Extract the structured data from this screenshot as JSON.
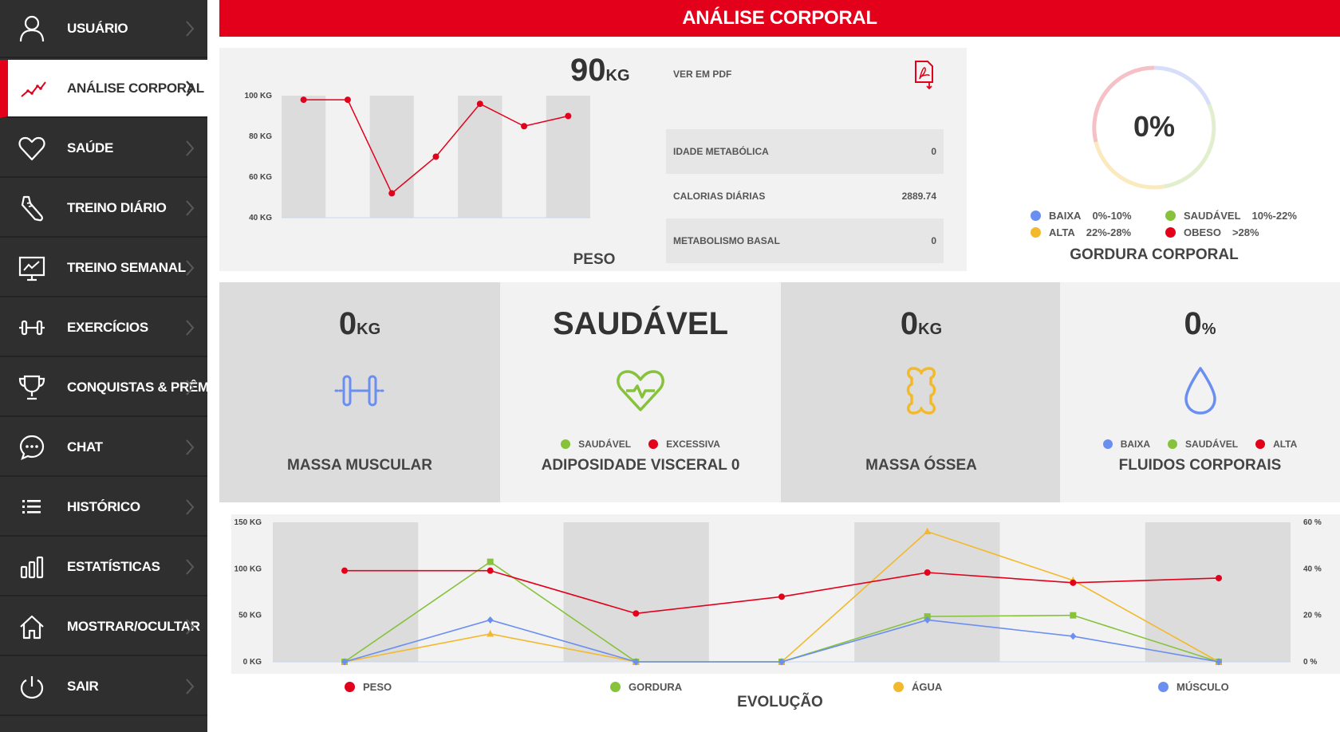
{
  "colors": {
    "brand_red": "#e3001b",
    "sidebar_bg": "#2f2f2f",
    "blue": "#6b8ff0",
    "green": "#86c23a",
    "yellow": "#f2b92d",
    "red": "#e3001b"
  },
  "sidebar": {
    "items": [
      {
        "label": "USUÁRIO",
        "icon": "user-icon",
        "active": false
      },
      {
        "label": "ANÁLISE CORPORAL",
        "icon": "trend-line-icon",
        "active": true
      },
      {
        "label": "SAÚDE",
        "icon": "heart-icon",
        "active": false
      },
      {
        "label": "TREINO DIÁRIO",
        "icon": "shoe-icon",
        "active": false
      },
      {
        "label": "TREINO SEMANAL",
        "icon": "presentation-board-icon",
        "active": false
      },
      {
        "label": "EXERCÍCIOS",
        "icon": "dumbbell-icon",
        "active": false
      },
      {
        "label": "CONQUISTAS & PRÊMIOS",
        "icon": "trophy-icon",
        "active": false
      },
      {
        "label": "CHAT",
        "icon": "chat-bubble-icon",
        "active": false
      },
      {
        "label": "HISTÓRICO",
        "icon": "list-icon",
        "active": false
      },
      {
        "label": "ESTATÍSTICAS",
        "icon": "bar-chart-icon",
        "active": false
      },
      {
        "label": "MOSTRAR/OCULTAR",
        "icon": "home-icon",
        "active": false
      },
      {
        "label": "SAIR",
        "icon": "power-icon",
        "active": false
      }
    ]
  },
  "header": {
    "title": "ANÁLISE CORPORAL"
  },
  "peso": {
    "value": "90",
    "unit": "KG",
    "title": "PESO",
    "chart_data": {
      "type": "line",
      "title": "",
      "ylabel": "",
      "ylim": [
        40,
        100
      ],
      "ytick_labels": [
        "100 KG",
        "80 KG",
        "60 KG",
        "40 KG"
      ],
      "ytick_values": [
        100,
        80,
        60,
        40
      ],
      "series": [
        {
          "values": [
            98,
            98,
            52,
            70,
            96,
            85,
            90
          ]
        }
      ]
    }
  },
  "stats": {
    "pdf_label": "VER EM PDF",
    "pdf_icon": "pdf-download-icon",
    "rows": [
      {
        "label": "IDADE METABÓLICA",
        "value": "0"
      },
      {
        "label": "CALORIAS DIÁRIAS",
        "value": "2889.74"
      },
      {
        "label": "METABOLISMO BASAL",
        "value": "0"
      }
    ]
  },
  "gordura": {
    "value": "0%",
    "title": "GORDURA CORPORAL",
    "legend": [
      {
        "label": "BAIXA",
        "range": "0%-10%",
        "color": "#6b8ff0"
      },
      {
        "label": "SAUDÁVEL",
        "range": "10%-22%",
        "color": "#86c23a"
      },
      {
        "label": "ALTA",
        "range": "22%-28%",
        "color": "#f2b92d"
      },
      {
        "label": "OBESO",
        "range": ">28%",
        "color": "#e3001b"
      }
    ]
  },
  "cards": {
    "massa_muscular": {
      "value": "0",
      "unit": "KG",
      "title": "MASSA MUSCULAR",
      "icon": "dumbbell-icon"
    },
    "adiposidade": {
      "value": "SAUDÁVEL",
      "title": "ADIPOSIDADE VISCERAL 0",
      "icon": "heart-icon",
      "legend": [
        {
          "label": "SAUDÁVEL",
          "color": "#86c23a"
        },
        {
          "label": "EXCESSIVA",
          "color": "#e3001b"
        }
      ]
    },
    "massa_ossea": {
      "value": "0",
      "unit": "KG",
      "title": "MASSA ÓSSEA",
      "icon": "bone-icon"
    },
    "fluidos": {
      "value": "0",
      "unit": "%",
      "title": "FLUIDOS CORPORAIS",
      "icon": "water-drop-icon",
      "legend": [
        {
          "label": "BAIXA",
          "color": "#6b8ff0"
        },
        {
          "label": "SAUDÁVEL",
          "color": "#86c23a"
        },
        {
          "label": "ALTA",
          "color": "#e3001b"
        }
      ]
    }
  },
  "evolucao": {
    "title": "EVOLUÇÃO",
    "chart_data": {
      "type": "line",
      "title": "",
      "ylim_left": [
        0,
        150
      ],
      "ylim_right": [
        0,
        60
      ],
      "ytick_left": [
        "150 KG",
        "100 KG",
        "50 KG",
        "0 KG"
      ],
      "ytick_left_values": [
        150,
        100,
        50,
        0
      ],
      "ytick_right": [
        "60 %",
        "40 %",
        "20 %",
        "0 %"
      ],
      "ytick_right_values": [
        60,
        40,
        20,
        0
      ],
      "series": [
        {
          "name": "PESO",
          "axis": "left",
          "color": "#e3001b",
          "marker": "circle",
          "values": [
            98,
            98,
            52,
            70,
            96,
            85,
            90
          ]
        },
        {
          "name": "GORDURA",
          "axis": "right",
          "color": "#86c23a",
          "marker": "square",
          "values": [
            0,
            43,
            0,
            0,
            19.5,
            20,
            0
          ]
        },
        {
          "name": "ÁGUA",
          "axis": "right",
          "color": "#f2b92d",
          "marker": "triangle",
          "values": [
            0,
            12,
            0,
            0,
            56,
            35,
            0
          ]
        },
        {
          "name": "MÚSCULO",
          "axis": "right",
          "color": "#6b8ff0",
          "marker": "diamond",
          "values": [
            0,
            18,
            0,
            0,
            18,
            11,
            0
          ]
        }
      ]
    }
  }
}
